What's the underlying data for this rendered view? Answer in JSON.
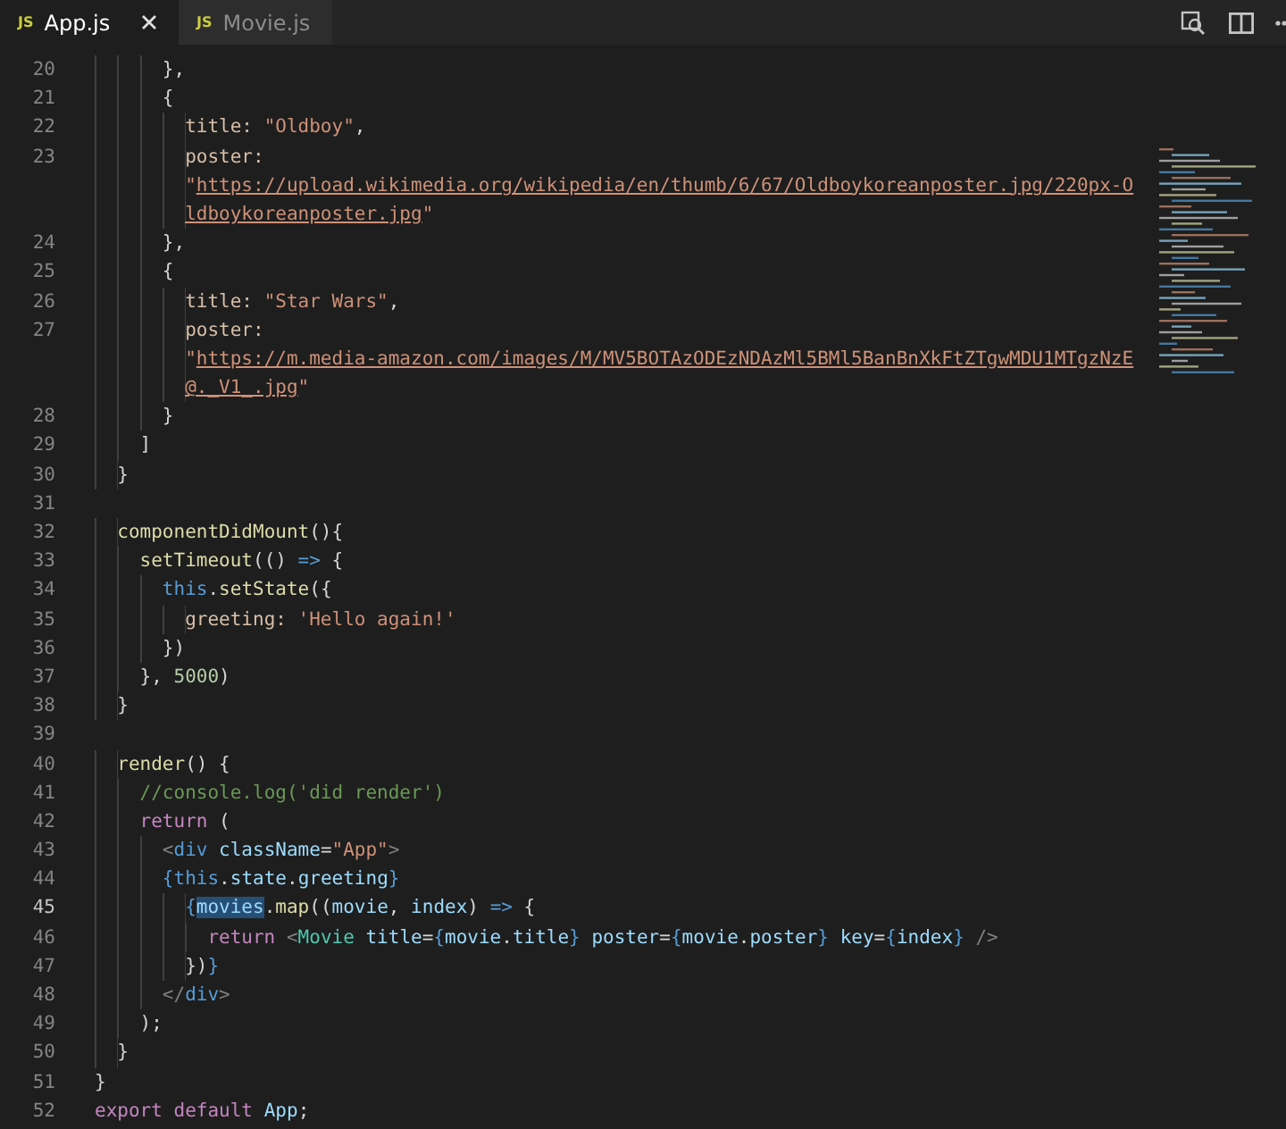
{
  "tabs": [
    {
      "badge": "JS",
      "label": "App.js",
      "selected": true
    },
    {
      "badge": "JS",
      "label": "Movie.js",
      "selected": false
    }
  ],
  "lines": [
    {
      "number": "20",
      "current": false,
      "rows": [
        [
          {
            "kind": "plain",
            "text": "      },"
          }
        ]
      ]
    },
    {
      "number": "21",
      "current": false,
      "rows": [
        [
          {
            "kind": "plain",
            "text": "      {"
          }
        ]
      ]
    },
    {
      "number": "22",
      "current": false,
      "rows": [
        [
          {
            "kind": "key",
            "text": "        title: "
          },
          {
            "kind": "str",
            "text": "\"Oldboy\""
          },
          {
            "kind": "plain",
            "text": ","
          }
        ]
      ]
    },
    {
      "number": "23",
      "current": false,
      "rows": [
        [
          {
            "kind": "key",
            "text": "        poster:"
          }
        ],
        [
          {
            "kind": "str",
            "text": "        \""
          },
          {
            "kind": "link",
            "text": "https://upload.wikimedia.org/wikipedia/en/thumb/6/67/Oldboykoreanposter.jpg/220px-O"
          }
        ],
        [
          {
            "kind": "link",
            "text": "        ldboykoreanposter.jpg"
          },
          {
            "kind": "str",
            "text": "\""
          }
        ]
      ]
    },
    {
      "number": "24",
      "current": false,
      "rows": [
        [
          {
            "kind": "plain",
            "text": "      },"
          }
        ]
      ]
    },
    {
      "number": "25",
      "current": false,
      "rows": [
        [
          {
            "kind": "plain",
            "text": "      {"
          }
        ]
      ]
    },
    {
      "number": "26",
      "current": false,
      "rows": [
        [
          {
            "kind": "key",
            "text": "        title: "
          },
          {
            "kind": "str",
            "text": "\"Star Wars\""
          },
          {
            "kind": "plain",
            "text": ","
          }
        ]
      ]
    },
    {
      "number": "27",
      "current": false,
      "rows": [
        [
          {
            "kind": "key",
            "text": "        poster:"
          }
        ],
        [
          {
            "kind": "str",
            "text": "        \""
          },
          {
            "kind": "link",
            "text": "https://m.media-amazon.com/images/M/MV5BOTAzODEzNDAzMl5BMl5BanBnXkFtZTgwMDU1MTgzNzE"
          }
        ],
        [
          {
            "kind": "link",
            "text": "        @._V1_.jpg"
          },
          {
            "kind": "str",
            "text": "\""
          }
        ]
      ]
    },
    {
      "number": "28",
      "current": false,
      "rows": [
        [
          {
            "kind": "plain",
            "text": "      }"
          }
        ]
      ]
    },
    {
      "number": "29",
      "current": false,
      "rows": [
        [
          {
            "kind": "plain",
            "text": "    ]"
          }
        ]
      ]
    },
    {
      "number": "30",
      "current": false,
      "rows": [
        [
          {
            "kind": "plain",
            "text": "  }"
          }
        ]
      ]
    },
    {
      "number": "31",
      "current": false
    },
    {
      "number": "32",
      "current": false,
      "rows": [
        [
          {
            "kind": "fn",
            "text": "  componentDidMount"
          },
          {
            "kind": "plain",
            "text": "(){"
          }
        ]
      ]
    },
    {
      "number": "33",
      "current": false,
      "rows": [
        [
          {
            "kind": "fn",
            "text": "    setTimeout"
          },
          {
            "kind": "plain",
            "text": "(() "
          },
          {
            "kind": "kw",
            "text": "=>"
          },
          {
            "kind": "plain",
            "text": " {"
          }
        ]
      ]
    },
    {
      "number": "34",
      "current": false,
      "rows": [
        [
          {
            "kind": "kw",
            "text": "      this"
          },
          {
            "kind": "plain",
            "text": "."
          },
          {
            "kind": "fn",
            "text": "setState"
          },
          {
            "kind": "plain",
            "text": "({"
          }
        ]
      ]
    },
    {
      "number": "35",
      "current": false,
      "rows": [
        [
          {
            "kind": "key",
            "text": "        greeting: "
          },
          {
            "kind": "str",
            "text": "'Hello again!'"
          }
        ]
      ]
    },
    {
      "number": "36",
      "current": false,
      "rows": [
        [
          {
            "kind": "plain",
            "text": "      })"
          }
        ]
      ]
    },
    {
      "number": "37",
      "current": false,
      "rows": [
        [
          {
            "kind": "plain",
            "text": "    }, "
          },
          {
            "kind": "num",
            "text": "5000"
          },
          {
            "kind": "plain",
            "text": ")"
          }
        ]
      ]
    },
    {
      "number": "38",
      "current": false,
      "rows": [
        [
          {
            "kind": "plain",
            "text": "  }"
          }
        ]
      ]
    },
    {
      "number": "39",
      "current": false
    },
    {
      "number": "40",
      "current": false,
      "rows": [
        [
          {
            "kind": "fn",
            "text": "  render"
          },
          {
            "kind": "plain",
            "text": "() {"
          }
        ]
      ]
    },
    {
      "number": "41",
      "current": false,
      "rows": [
        [
          {
            "kind": "comment",
            "text": "    //console.log('did render')"
          }
        ]
      ]
    },
    {
      "number": "42",
      "current": false,
      "rows": [
        [
          {
            "kind": "ctl",
            "text": "    return"
          },
          {
            "kind": "plain",
            "text": " ("
          }
        ]
      ]
    },
    {
      "number": "43",
      "current": false,
      "rows": [
        [
          {
            "kind": "punct",
            "text": "      <"
          },
          {
            "kind": "tag",
            "text": "div"
          },
          {
            "kind": "attr",
            "text": " className"
          },
          {
            "kind": "plain",
            "text": "="
          },
          {
            "kind": "str",
            "text": "\"App\""
          },
          {
            "kind": "punct",
            "text": ">"
          }
        ]
      ]
    },
    {
      "number": "44",
      "current": false,
      "rows": [
        [
          {
            "kind": "brace",
            "text": "      {"
          },
          {
            "kind": "kw",
            "text": "this"
          },
          {
            "kind": "plain",
            "text": "."
          },
          {
            "kind": "prop",
            "text": "state"
          },
          {
            "kind": "plain",
            "text": "."
          },
          {
            "kind": "prop",
            "text": "greeting"
          },
          {
            "kind": "brace",
            "text": "}"
          }
        ]
      ]
    },
    {
      "number": "45",
      "current": true,
      "rows": [
        [
          {
            "kind": "brace",
            "text": "        {"
          },
          {
            "kind": "sel",
            "text": "movies"
          },
          {
            "kind": "plain",
            "text": "."
          },
          {
            "kind": "fn",
            "text": "map"
          },
          {
            "kind": "plain",
            "text": "(("
          },
          {
            "kind": "prop",
            "text": "movie"
          },
          {
            "kind": "plain",
            "text": ", "
          },
          {
            "kind": "prop",
            "text": "index"
          },
          {
            "kind": "plain",
            "text": ") "
          },
          {
            "kind": "kw",
            "text": "=>"
          },
          {
            "kind": "plain",
            "text": " {"
          }
        ]
      ]
    },
    {
      "number": "46",
      "current": false,
      "rows": [
        [
          {
            "kind": "ctl",
            "text": "          return"
          },
          {
            "kind": "punct",
            "text": " <"
          },
          {
            "kind": "comp",
            "text": "Movie"
          },
          {
            "kind": "attr",
            "text": " title"
          },
          {
            "kind": "plain",
            "text": "="
          },
          {
            "kind": "brace",
            "text": "{"
          },
          {
            "kind": "prop",
            "text": "movie"
          },
          {
            "kind": "plain",
            "text": "."
          },
          {
            "kind": "prop",
            "text": "title"
          },
          {
            "kind": "brace",
            "text": "}"
          },
          {
            "kind": "attr",
            "text": " poster"
          },
          {
            "kind": "plain",
            "text": "="
          },
          {
            "kind": "brace",
            "text": "{"
          },
          {
            "kind": "prop",
            "text": "movie"
          },
          {
            "kind": "plain",
            "text": "."
          },
          {
            "kind": "prop",
            "text": "poster"
          },
          {
            "kind": "brace",
            "text": "}"
          },
          {
            "kind": "attr",
            "text": " key"
          },
          {
            "kind": "plain",
            "text": "="
          },
          {
            "kind": "brace",
            "text": "{"
          },
          {
            "kind": "prop",
            "text": "index"
          },
          {
            "kind": "brace",
            "text": "}"
          },
          {
            "kind": "punct",
            "text": " />"
          }
        ]
      ]
    },
    {
      "number": "47",
      "current": false,
      "rows": [
        [
          {
            "kind": "plain",
            "text": "        })"
          },
          {
            "kind": "brace",
            "text": "}"
          }
        ]
      ]
    },
    {
      "number": "48",
      "current": false,
      "rows": [
        [
          {
            "kind": "punct",
            "text": "      </"
          },
          {
            "kind": "tag",
            "text": "div"
          },
          {
            "kind": "punct",
            "text": ">"
          }
        ]
      ]
    },
    {
      "number": "49",
      "current": false,
      "rows": [
        [
          {
            "kind": "plain",
            "text": "    );"
          }
        ]
      ]
    },
    {
      "number": "50",
      "current": false,
      "rows": [
        [
          {
            "kind": "plain",
            "text": "  }"
          }
        ]
      ]
    },
    {
      "number": "51",
      "current": false,
      "rows": [
        [
          {
            "kind": "plain",
            "text": "}"
          }
        ]
      ]
    },
    {
      "number": "52",
      "current": false,
      "rows": [
        [
          {
            "kind": "ctl",
            "text": "export default"
          },
          {
            "kind": "prop",
            "text": " App"
          },
          {
            "kind": "plain",
            "text": ";"
          }
        ]
      ]
    }
  ]
}
